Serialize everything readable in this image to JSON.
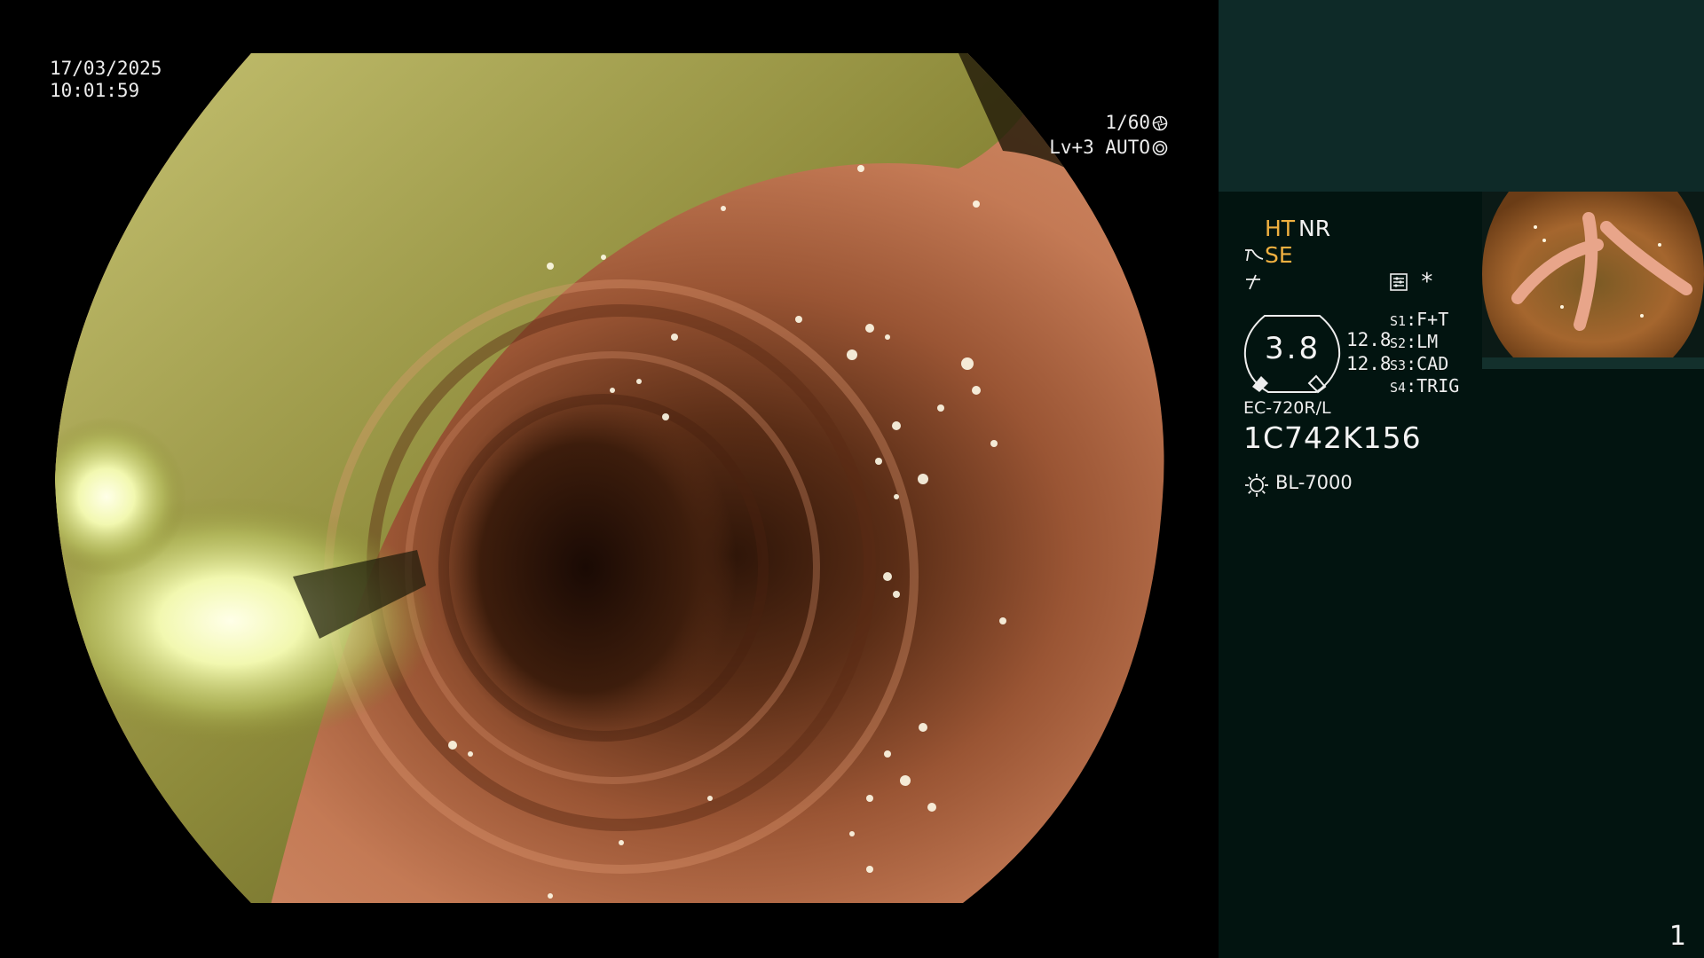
{
  "overlay": {
    "date": "17/03/2025",
    "time": "10:01:59",
    "shutter": "1/60",
    "level": "Lv+3 AUTO"
  },
  "panel": {
    "mode_ht": "HT",
    "mode_nr": "NR",
    "mode_se": "SE",
    "asterisk": "*",
    "gauge_value": "3.8",
    "value_a": "12.8",
    "value_b": "12.8",
    "switches": [
      {
        "key": "S1",
        "label": "F+T"
      },
      {
        "key": "S2",
        "label": "LM"
      },
      {
        "key": "S3",
        "label": "CAD"
      },
      {
        "key": "S4",
        "label": "TRIG"
      }
    ],
    "scope_model": "EC-720R/L",
    "serial_number": "1C742K156",
    "light_source": "BL-7000",
    "page_number": "1"
  },
  "colors": {
    "accent_orange": "#f0b040",
    "panel_bg": "#021410",
    "panel_top_bg": "#0e2a28"
  },
  "icons": [
    "shutter-icon",
    "auto-iris-icon",
    "se-icon",
    "flash-icon",
    "settings-icon",
    "gauge-icon",
    "light-source-icon"
  ]
}
